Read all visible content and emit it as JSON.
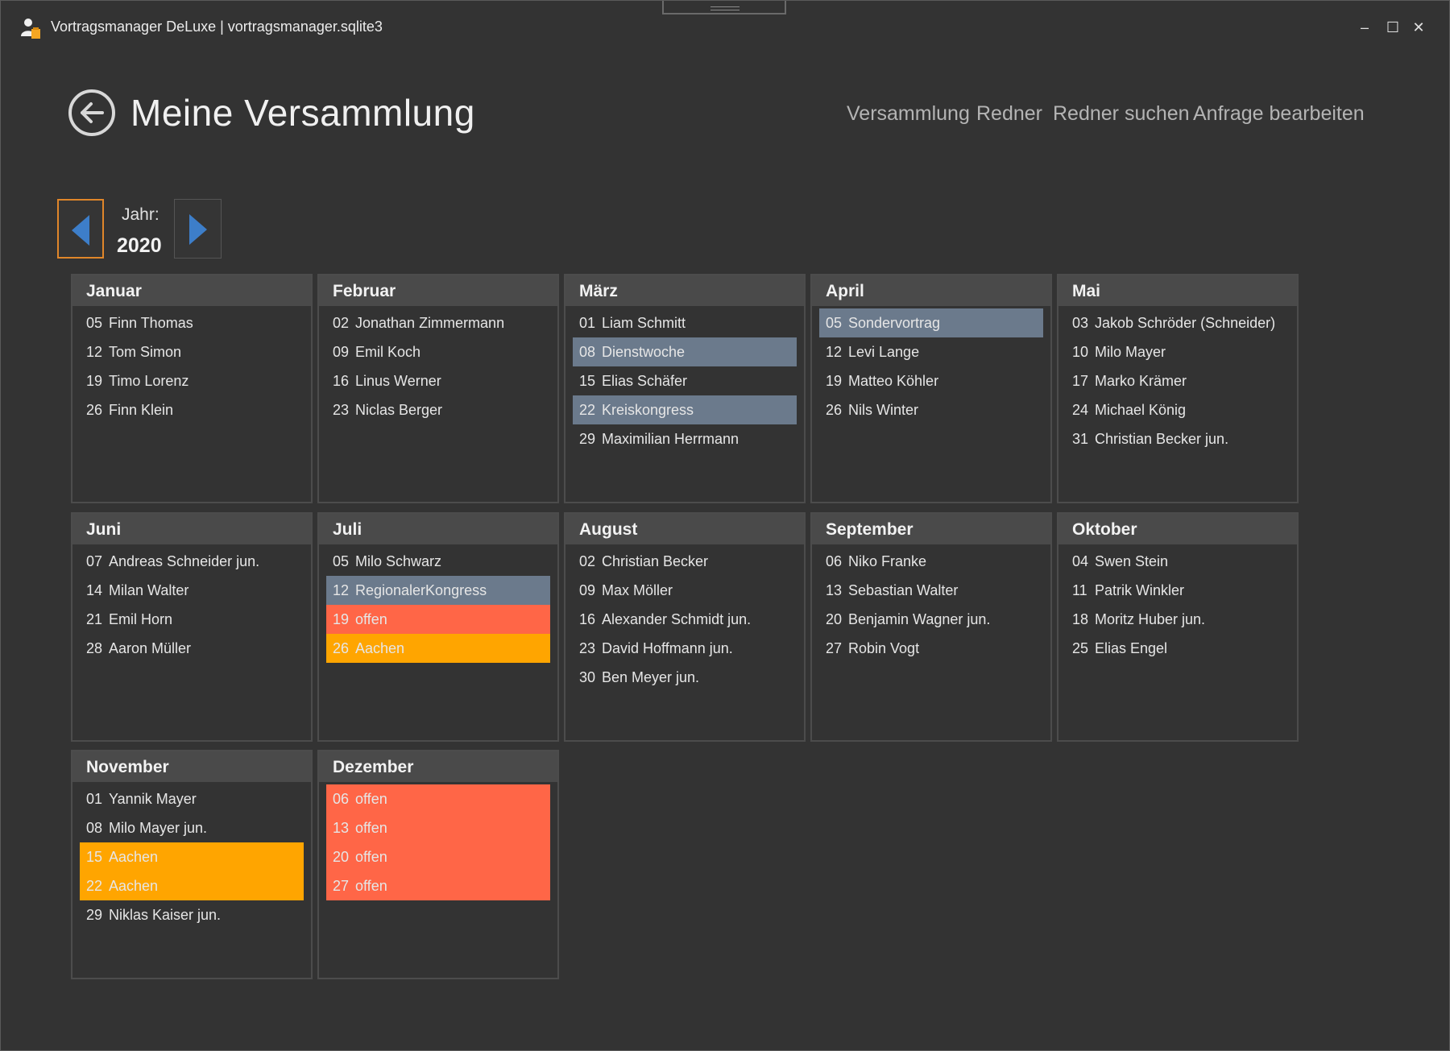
{
  "window": {
    "title": "Vortragsmanager DeLuxe | vortragsmanager.sqlite3",
    "minimize": "–",
    "maximize": "☐",
    "close": "✕"
  },
  "header": {
    "title": "Meine Versammlung",
    "nav": [
      "Versammlung",
      "Redner",
      "Redner suchen",
      "Anfrage bearbeiten"
    ]
  },
  "year": {
    "label": "Jahr:",
    "value": "2020"
  },
  "colors": {
    "highlight": "#6b7a8c",
    "open": "#ff6647",
    "external": "#ffa500"
  },
  "months": [
    {
      "name": "Januar",
      "entries": [
        {
          "day": "05",
          "text": "Finn Thomas",
          "status": ""
        },
        {
          "day": "12",
          "text": "Tom Simon",
          "status": ""
        },
        {
          "day": "19",
          "text": "Timo Lorenz",
          "status": ""
        },
        {
          "day": "26",
          "text": "Finn Klein",
          "status": ""
        }
      ]
    },
    {
      "name": "Februar",
      "entries": [
        {
          "day": "02",
          "text": "Jonathan Zimmermann",
          "status": ""
        },
        {
          "day": "09",
          "text": "Emil Koch",
          "status": ""
        },
        {
          "day": "16",
          "text": "Linus Werner",
          "status": ""
        },
        {
          "day": "23",
          "text": "Niclas Berger",
          "status": ""
        }
      ]
    },
    {
      "name": "März",
      "entries": [
        {
          "day": "01",
          "text": "Liam Schmitt",
          "status": ""
        },
        {
          "day": "08",
          "text": "Dienstwoche",
          "status": "hl"
        },
        {
          "day": "15",
          "text": "Elias Schäfer",
          "status": ""
        },
        {
          "day": "22",
          "text": "Kreiskongress",
          "status": "hl"
        },
        {
          "day": "29",
          "text": "Maximilian Herrmann",
          "status": ""
        }
      ]
    },
    {
      "name": "April",
      "entries": [
        {
          "day": "05",
          "text": "Sondervortrag",
          "status": "hl"
        },
        {
          "day": "12",
          "text": "Levi Lange",
          "status": ""
        },
        {
          "day": "19",
          "text": "Matteo Köhler",
          "status": ""
        },
        {
          "day": "26",
          "text": "Nils Winter",
          "status": ""
        }
      ]
    },
    {
      "name": "Mai",
      "entries": [
        {
          "day": "03",
          "text": "Jakob Schröder (Schneider)",
          "status": ""
        },
        {
          "day": "10",
          "text": "Milo Mayer",
          "status": ""
        },
        {
          "day": "17",
          "text": "Marko Krämer",
          "status": ""
        },
        {
          "day": "24",
          "text": "Michael König",
          "status": ""
        },
        {
          "day": "31",
          "text": "Christian Becker jun.",
          "status": ""
        }
      ]
    },
    {
      "name": "Juni",
      "entries": [
        {
          "day": "07",
          "text": "Andreas Schneider jun.",
          "status": ""
        },
        {
          "day": "14",
          "text": "Milan Walter",
          "status": ""
        },
        {
          "day": "21",
          "text": "Emil Horn",
          "status": ""
        },
        {
          "day": "28",
          "text": "Aaron Müller",
          "status": ""
        }
      ]
    },
    {
      "name": "Juli",
      "entries": [
        {
          "day": "05",
          "text": "Milo Schwarz",
          "status": ""
        },
        {
          "day": "12",
          "text": "RegionalerKongress",
          "status": "hl"
        },
        {
          "day": "19",
          "text": "offen",
          "status": "open"
        },
        {
          "day": "26",
          "text": "Aachen",
          "status": "ext"
        }
      ]
    },
    {
      "name": "August",
      "entries": [
        {
          "day": "02",
          "text": "Christian Becker",
          "status": ""
        },
        {
          "day": "09",
          "text": "Max Möller",
          "status": ""
        },
        {
          "day": "16",
          "text": "Alexander Schmidt jun.",
          "status": ""
        },
        {
          "day": "23",
          "text": "David Hoffmann jun.",
          "status": ""
        },
        {
          "day": "30",
          "text": "Ben Meyer jun.",
          "status": ""
        }
      ]
    },
    {
      "name": "September",
      "entries": [
        {
          "day": "06",
          "text": "Niko Franke",
          "status": ""
        },
        {
          "day": "13",
          "text": "Sebastian Walter",
          "status": ""
        },
        {
          "day": "20",
          "text": "Benjamin Wagner jun.",
          "status": ""
        },
        {
          "day": "27",
          "text": "Robin Vogt",
          "status": ""
        }
      ]
    },
    {
      "name": "Oktober",
      "entries": [
        {
          "day": "04",
          "text": "Swen Stein",
          "status": ""
        },
        {
          "day": "11",
          "text": "Patrik Winkler",
          "status": ""
        },
        {
          "day": "18",
          "text": "Moritz Huber jun.",
          "status": ""
        },
        {
          "day": "25",
          "text": "Elias Engel",
          "status": ""
        }
      ]
    },
    {
      "name": "November",
      "entries": [
        {
          "day": "01",
          "text": "Yannik Mayer",
          "status": ""
        },
        {
          "day": "08",
          "text": "Milo Mayer jun.",
          "status": ""
        },
        {
          "day": "15",
          "text": "Aachen",
          "status": "ext"
        },
        {
          "day": "22",
          "text": "Aachen",
          "status": "ext"
        },
        {
          "day": "29",
          "text": "Niklas Kaiser jun.",
          "status": ""
        }
      ]
    },
    {
      "name": "Dezember",
      "entries": [
        {
          "day": "06",
          "text": "offen",
          "status": "open"
        },
        {
          "day": "13",
          "text": "offen",
          "status": "open"
        },
        {
          "day": "20",
          "text": "offen",
          "status": "open"
        },
        {
          "day": "27",
          "text": "offen",
          "status": "open"
        }
      ]
    }
  ]
}
